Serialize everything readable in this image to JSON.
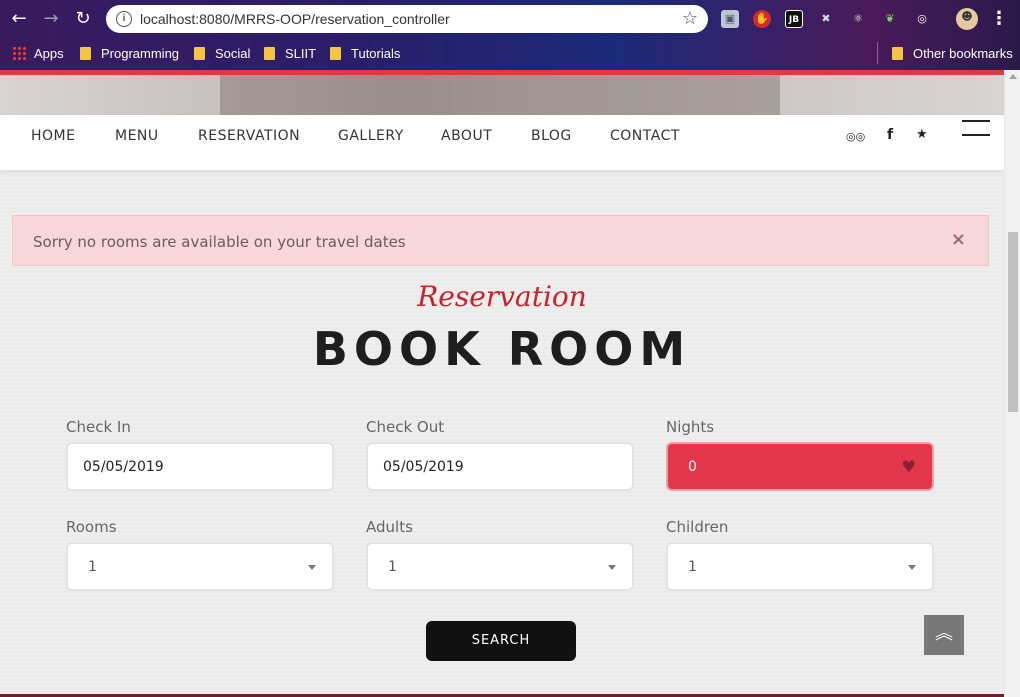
{
  "browser": {
    "url": "localhost:8080/MRRS-OOP/reservation_controller",
    "bookmarks": [
      "Apps",
      "Programming",
      "Social",
      "SLIIT",
      "Tutorials"
    ],
    "other_bookmarks": "Other bookmarks",
    "extensions": [
      "cube-icon",
      "hand-stop-icon",
      "jb-icon",
      "tool-icon",
      "react-icon",
      "leaf-icon",
      "target-icon"
    ],
    "jb_label": "JB"
  },
  "nav": {
    "items": [
      "HOME",
      "MENU",
      "RESERVATION",
      "GALLERY",
      "ABOUT",
      "BLOG",
      "CONTACT"
    ],
    "social": [
      "tripadvisor-icon",
      "facebook-icon",
      "twitter-icon"
    ],
    "social_glyphs": [
      "◎◎",
      "f",
      "★"
    ]
  },
  "alert": {
    "message": "Sorry no rooms are available on your travel dates",
    "close": "×"
  },
  "section": {
    "subtitle": "Reservation",
    "title": "BOOK ROOM"
  },
  "form": {
    "check_in": {
      "label": "Check In",
      "value": "05/05/2019"
    },
    "check_out": {
      "label": "Check Out",
      "value": "05/05/2019"
    },
    "nights": {
      "label": "Nights",
      "value": "0"
    },
    "rooms": {
      "label": "Rooms",
      "value": "1"
    },
    "adults": {
      "label": "Adults",
      "value": "1"
    },
    "children": {
      "label": "Children",
      "value": "1"
    },
    "search_label": "SEARCH"
  },
  "colors": {
    "accent_red": "#e3364a",
    "alert_bg": "#f8d7da",
    "title_red": "#c8222b"
  }
}
